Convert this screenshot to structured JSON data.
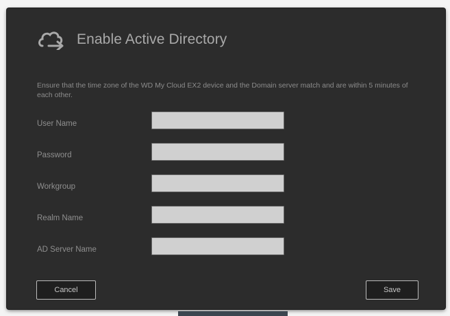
{
  "dialog": {
    "title": "Enable Active Directory",
    "icon": "cloud-sync-icon",
    "notice": "Ensure that the time zone of the WD My Cloud EX2 device and the Domain server match and are within 5 minutes of each other."
  },
  "form": {
    "fields": [
      {
        "label": "User Name",
        "value": "",
        "placeholder": ""
      },
      {
        "label": "Password",
        "value": "",
        "placeholder": ""
      },
      {
        "label": "Workgroup",
        "value": "",
        "placeholder": ""
      },
      {
        "label": "Realm Name",
        "value": "",
        "placeholder": ""
      },
      {
        "label": "AD Server Name",
        "value": "",
        "placeholder": ""
      }
    ]
  },
  "buttons": {
    "cancel_label": "Cancel",
    "save_label": "Save"
  },
  "colors": {
    "dialog_background": "#2c2c2c",
    "title_text": "#a9a9a9",
    "input_background": "#d0d0d0",
    "button_border": "#bdbdbd"
  }
}
